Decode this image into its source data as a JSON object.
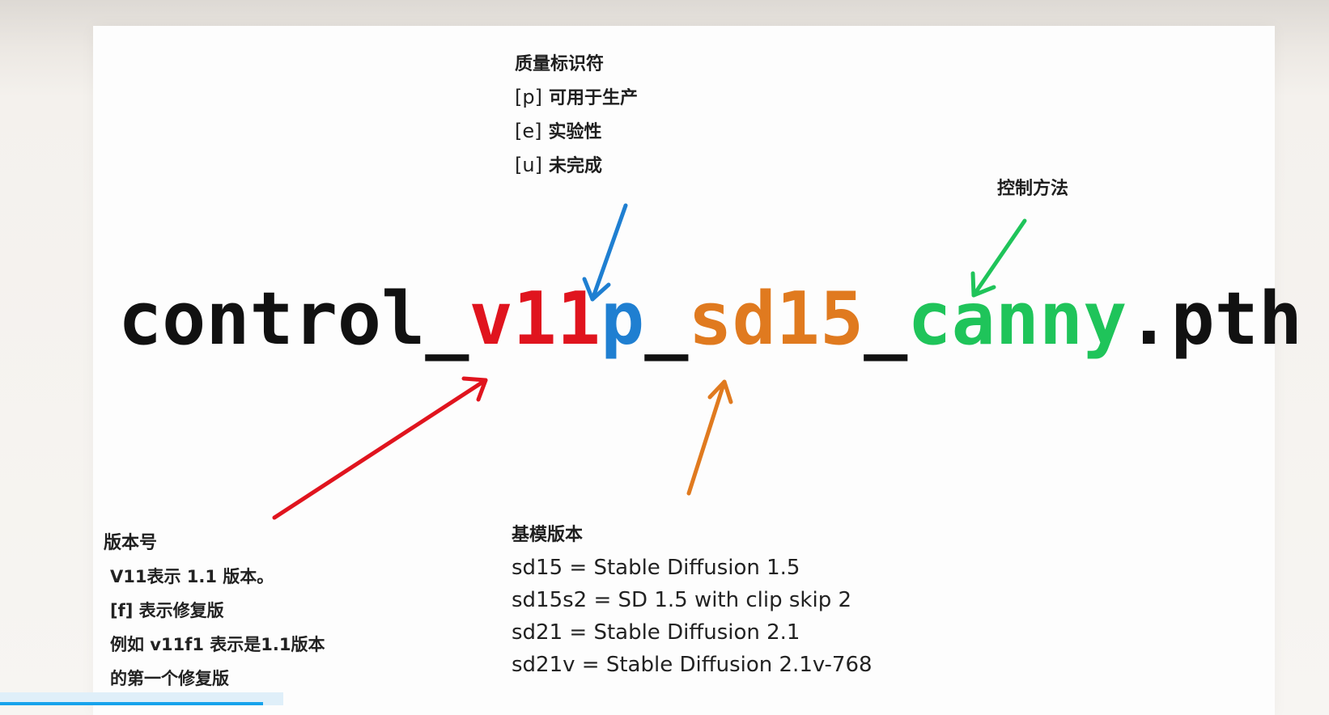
{
  "filename": {
    "parts": [
      {
        "text": "control_",
        "color": "#111111"
      },
      {
        "text": "v11",
        "color": "#e0141e"
      },
      {
        "text": "p",
        "color": "#1f7fd1"
      },
      {
        "text": "_",
        "color": "#111111"
      },
      {
        "text": "sd15",
        "color": "#e07a1f"
      },
      {
        "text": "_",
        "color": "#111111"
      },
      {
        "text": "canny",
        "color": "#1fc45a"
      },
      {
        "text": ".pth",
        "color": "#111111"
      }
    ]
  },
  "quality": {
    "heading": "质量标识符",
    "items": [
      {
        "code": "[p]",
        "desc": "可用于生产"
      },
      {
        "code": "[e]",
        "desc": "实验性"
      },
      {
        "code": "[u]",
        "desc": "未完成"
      }
    ]
  },
  "method": {
    "heading": "控制方法"
  },
  "version": {
    "heading": "版本号",
    "lines": [
      "V11表示 1.1 版本。",
      "[f] 表示修复版",
      "例如 v11f1 表示是1.1版本",
      "的第一个修复版"
    ]
  },
  "base": {
    "heading": "基模版本",
    "lines": [
      "sd15 = Stable Diffusion 1.5",
      "sd15s2 = SD 1.5 with clip skip 2",
      "sd21 = Stable Diffusion 2.1",
      "sd21v = Stable Diffusion 2.1v-768"
    ]
  },
  "colors": {
    "version_arrow": "#e0141e",
    "quality_arrow": "#1f7fd1",
    "base_arrow": "#e07a1f",
    "method_arrow": "#1fc45a",
    "progress": "#16a3ec"
  },
  "video_progress": 0.33
}
